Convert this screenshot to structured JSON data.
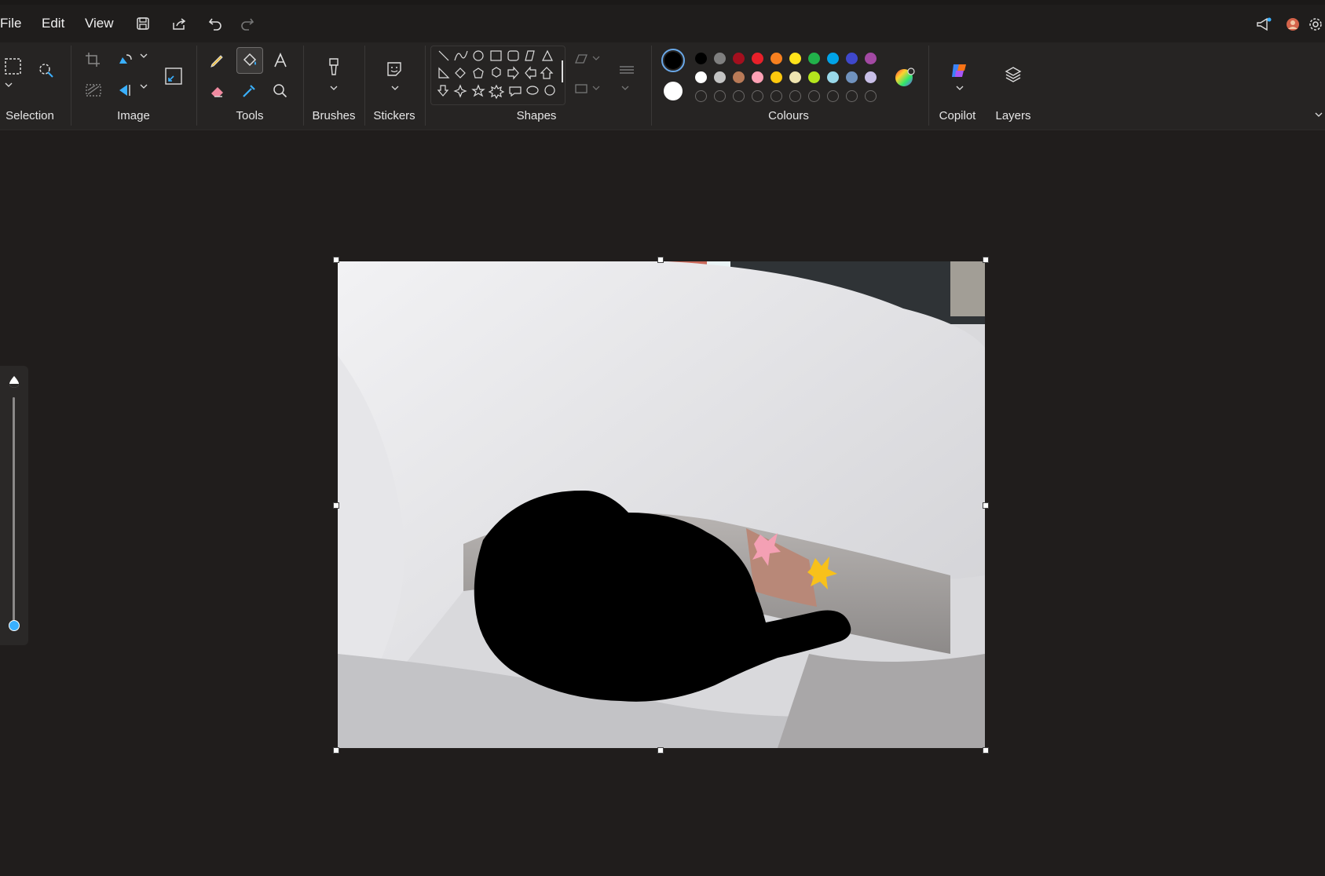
{
  "menu": {
    "file": "File",
    "edit": "Edit",
    "view": "View"
  },
  "ribbon": {
    "groups": {
      "selection": "Selection",
      "image": "Image",
      "tools": "Tools",
      "brushes": "Brushes",
      "stickers": "Stickers",
      "shapes": "Shapes",
      "colours": "Colours",
      "copilot": "Copilot",
      "layers": "Layers"
    }
  },
  "colours": {
    "primary": "#000000",
    "secondary": "#ffffff",
    "row1": [
      "#000000",
      "#7f7f7f",
      "#a30f1e",
      "#e8202a",
      "#f7801f",
      "#ffe31a",
      "#21b14a",
      "#00a3e8",
      "#3f48cc",
      "#a349a3"
    ],
    "row2": [
      "#ffffff",
      "#c3c3c3",
      "#b97a57",
      "#fea1b5",
      "#ffc90d",
      "#efe4b0",
      "#b5e61d",
      "#99d9ea",
      "#7092be",
      "#c8bfe7"
    ]
  },
  "canvas": {
    "width": 824,
    "height": 620
  },
  "zoom": {
    "level": 0.0
  }
}
